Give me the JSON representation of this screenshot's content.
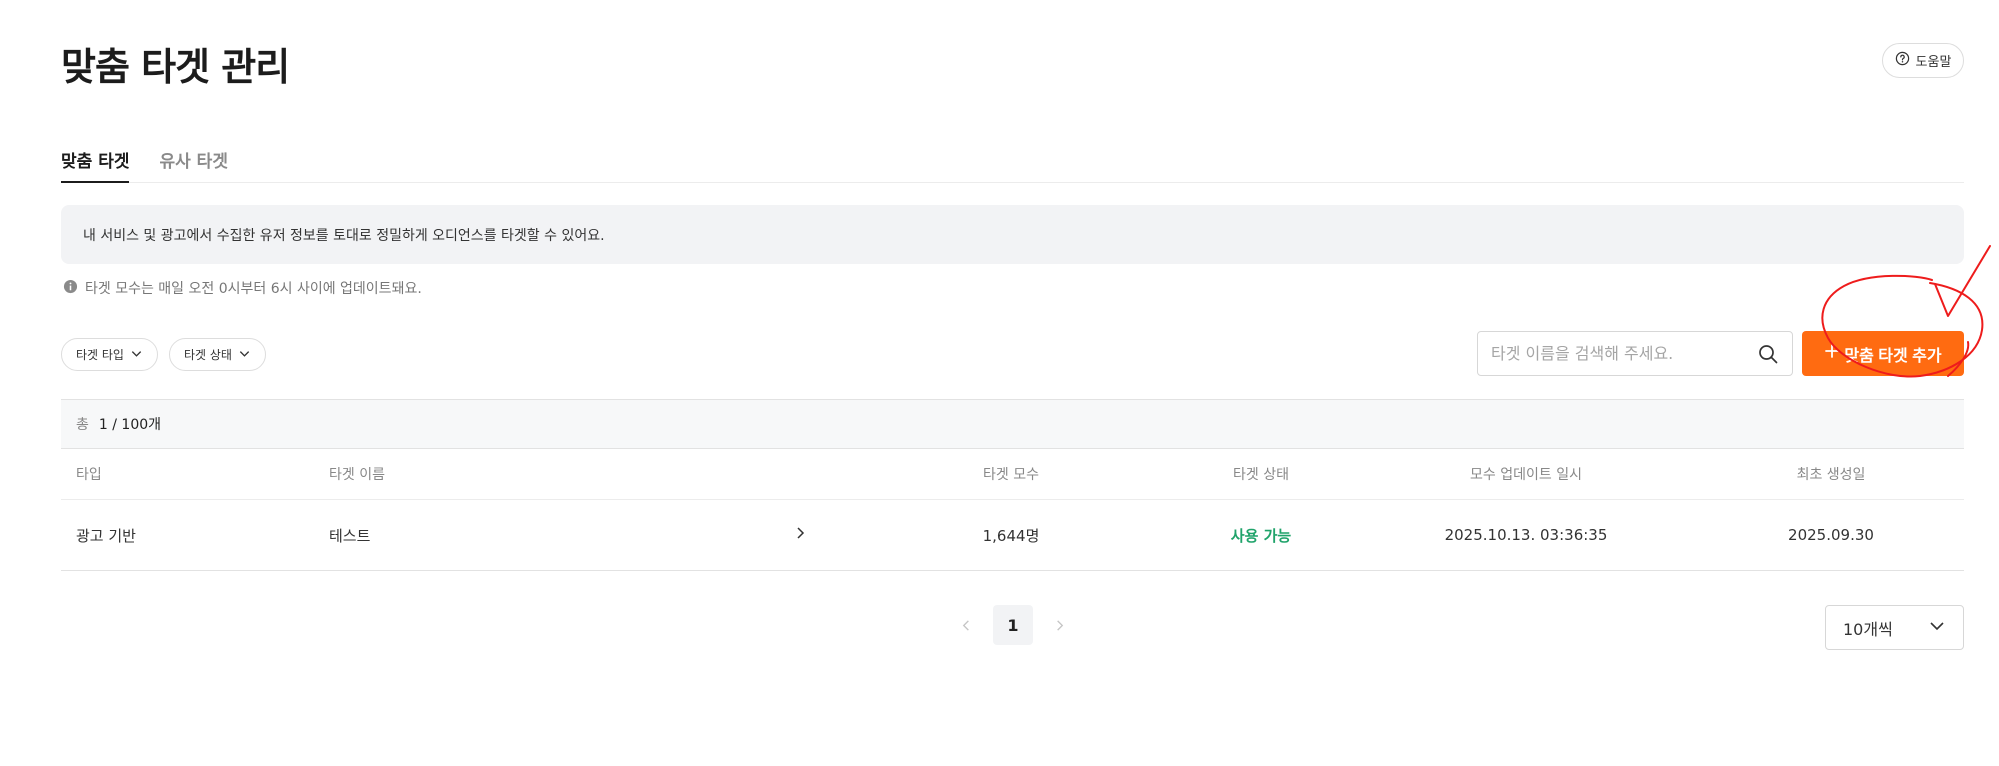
{
  "header": {
    "title": "맞춤 타겟 관리",
    "help_label": "도움말"
  },
  "tabs": [
    {
      "label": "맞춤 타겟",
      "active": true
    },
    {
      "label": "유사 타겟",
      "active": false
    }
  ],
  "info_message": "내 서비스 및 광고에서 수집한 유저 정보를 토대로 정밀하게 오디언스를 타겟할 수 있어요.",
  "notice": "타겟 모수는 매일 오전 0시부터 6시 사이에 업데이트돼요.",
  "filters": {
    "type_label": "타겟 타입",
    "status_label": "타겟 상태"
  },
  "search": {
    "value": "",
    "placeholder": "타겟 이름을 검색해 주세요."
  },
  "add_button": {
    "label": "맞춤 타겟 추가",
    "color": "#ff6b11"
  },
  "summary": {
    "total_label": "총",
    "total_value": "1 / 100개"
  },
  "table": {
    "columns": [
      "타입",
      "타겟 이름",
      "타겟 모수",
      "타겟 상태",
      "모수 업데이트 일시",
      "최초 생성일"
    ],
    "rows": [
      {
        "type": "광고 기반",
        "name": "테스트",
        "count": "1,644명",
        "status": "사용 가능",
        "updated": "2025.10.13. 03:36:35",
        "created": "2025.09.30"
      }
    ]
  },
  "pagination": {
    "current_page": "1"
  },
  "page_size": {
    "selected": "10개씩"
  },
  "colors": {
    "accent": "#ff6b11",
    "status_ok": "#1fa36a",
    "annotation": "#ee1c1c"
  },
  "icons": [
    "help-circle-icon",
    "info-icon",
    "chevron-down-icon",
    "search-icon",
    "plus-icon",
    "chevron-right-icon",
    "chevron-left-icon"
  ]
}
